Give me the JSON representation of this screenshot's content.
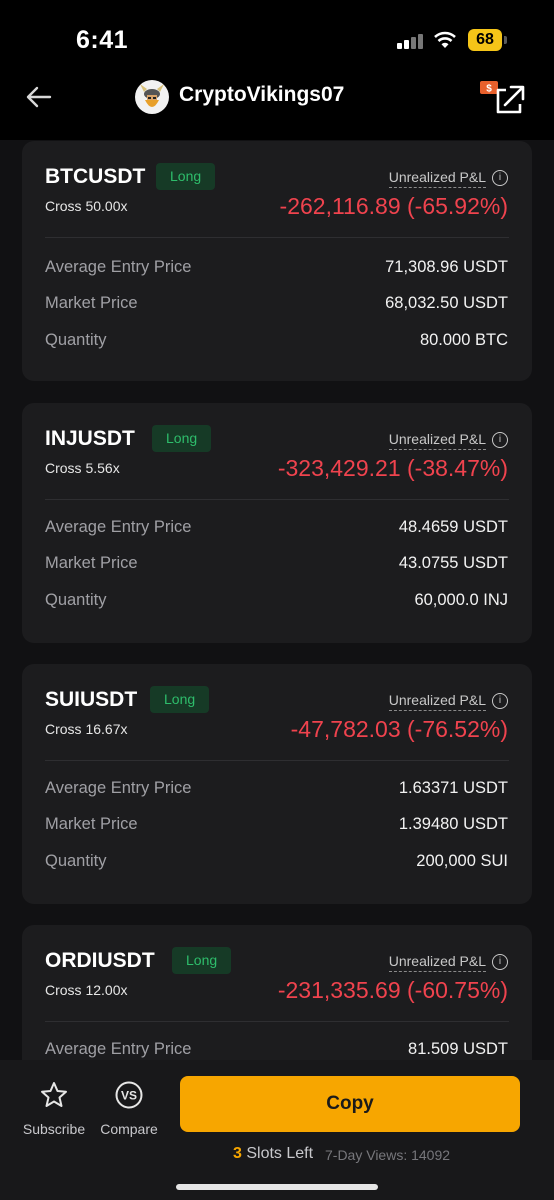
{
  "status_bar": {
    "time": "6:41",
    "battery": "68"
  },
  "header": {
    "username": "CryptoVikings07",
    "icons": [
      "back-arrow-icon",
      "avatar",
      "share-icon"
    ]
  },
  "positions": [
    {
      "symbol": "BTCUSDT",
      "side": "Long",
      "leverage": "Cross 50.00x",
      "pnl_label": "Unrealized P&L",
      "pnl": "-262,116.89 (-65.92%)",
      "rows": [
        {
          "label": "Average Entry Price",
          "value": "71,308.96 USDT"
        },
        {
          "label": "Market Price",
          "value": "68,032.50 USDT"
        },
        {
          "label": "Quantity",
          "value": "80.000 BTC"
        }
      ]
    },
    {
      "symbol": "INJUSDT",
      "side": "Long",
      "leverage": "Cross 5.56x",
      "pnl_label": "Unrealized P&L",
      "pnl": "-323,429.21 (-38.47%)",
      "rows": [
        {
          "label": "Average Entry Price",
          "value": "48.4659 USDT"
        },
        {
          "label": "Market Price",
          "value": "43.0755 USDT"
        },
        {
          "label": "Quantity",
          "value": "60,000.0 INJ"
        }
      ]
    },
    {
      "symbol": "SUIUSDT",
      "side": "Long",
      "leverage": "Cross 16.67x",
      "pnl_label": "Unrealized P&L",
      "pnl": "-47,782.03 (-76.52%)",
      "rows": [
        {
          "label": "Average Entry Price",
          "value": "1.63371 USDT"
        },
        {
          "label": "Market Price",
          "value": "1.39480 USDT"
        },
        {
          "label": "Quantity",
          "value": "200,000 SUI"
        }
      ]
    },
    {
      "symbol": "ORDIUSDT",
      "side": "Long",
      "leverage": "Cross 12.00x",
      "pnl_label": "Unrealized P&L",
      "pnl": "-231,335.69 (-60.75%)",
      "rows": [
        {
          "label": "Average Entry Price",
          "value": "81.509 USDT"
        }
      ]
    }
  ],
  "bottom": {
    "subscribe_label": "Subscribe",
    "compare_label": "Compare",
    "compare_icon_text": "VS",
    "copy_label": "Copy",
    "slots_count": "3",
    "slots_text": "Slots Left",
    "views_text": "7-Day Views: 14092"
  },
  "colors": {
    "accent": "#f7a600",
    "loss": "#f0434e",
    "long": "#2ebd6b",
    "card": "#1c1c1e"
  }
}
